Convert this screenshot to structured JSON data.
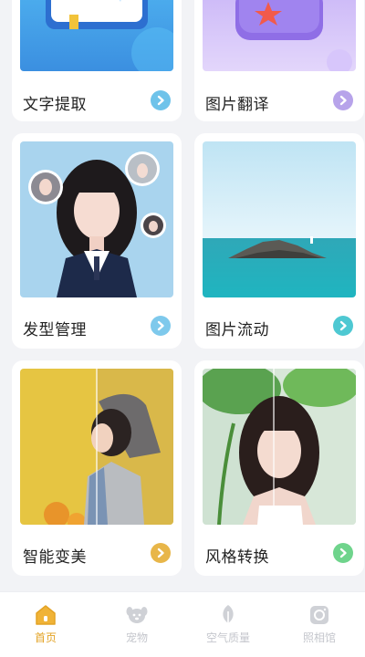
{
  "cards": [
    {
      "id": "c1",
      "label": "文字提取",
      "button_color": "#6ec3ea",
      "thumb": "text-extract-illustration"
    },
    {
      "id": "c2",
      "label": "图片翻译",
      "button_color": "#b7a3ea",
      "thumb": "image-translate-illustration"
    },
    {
      "id": "c3",
      "label": "发型管理",
      "button_color": "#7ec9ec",
      "thumb": "hairstyle-photo"
    },
    {
      "id": "c4",
      "label": "图片流动",
      "button_color": "#4ec8d2",
      "thumb": "seascape-photo"
    },
    {
      "id": "c5",
      "label": "智能变美",
      "button_color": "#e8b649",
      "thumb": "beauty-before-after-photo"
    },
    {
      "id": "c6",
      "label": "风格转换",
      "button_color": "#6fd48c",
      "thumb": "style-transfer-photo"
    }
  ],
  "tabbar": {
    "active_color": "#e3a325",
    "inactive_color": "#c4c6cc",
    "tabs": [
      {
        "label": "首页",
        "icon": "home-icon",
        "active": true
      },
      {
        "label": "宠物",
        "icon": "pet-icon",
        "active": false
      },
      {
        "label": "空气质量",
        "icon": "leaf-icon",
        "active": false
      },
      {
        "label": "照相馆",
        "icon": "camera-icon",
        "active": false
      }
    ]
  }
}
